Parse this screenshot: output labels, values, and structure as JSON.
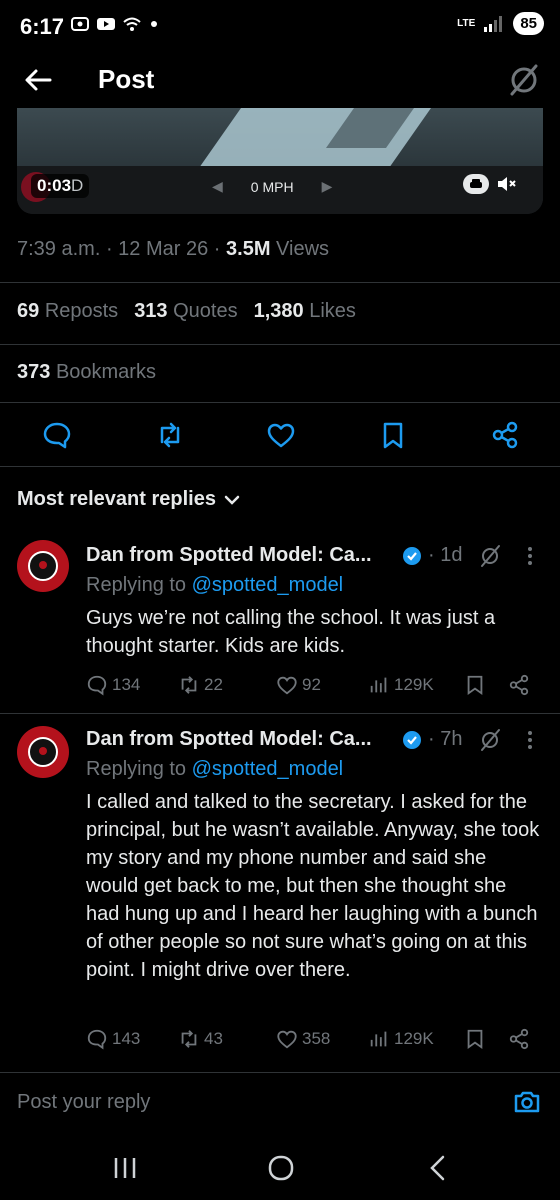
{
  "status_bar": {
    "time": "6:17",
    "network": "LTE",
    "battery": "85"
  },
  "header": {
    "title": "Post",
    "icons": [
      "back-arrow-icon",
      "grok-icon"
    ]
  },
  "video": {
    "elapsed": "0:03",
    "elapsed_suffix": "D",
    "speed": "0 MPH"
  },
  "post_meta": {
    "time": "7:39 a.m.",
    "date": "12 Mar 26",
    "views_count": "3.5M",
    "views_label": "Views"
  },
  "engagement": {
    "reposts_count": "69",
    "reposts_label": "Reposts",
    "quotes_count": "313",
    "quotes_label": "Quotes",
    "likes_count": "1,380",
    "likes_label": "Likes",
    "bookmarks_count": "373",
    "bookmarks_label": "Bookmarks"
  },
  "replies_header": {
    "label": "Most relevant replies"
  },
  "replies": [
    {
      "author": "Dan from Spotted Model: Ca...",
      "time": "1d",
      "replying_prefix": "Replying to",
      "replying_handle": "@spotted_model",
      "text": "Guys we’re not calling the school. It was just a thought starter. Kids are kids.",
      "replies": "134",
      "reposts": "22",
      "likes": "92",
      "views": "129K"
    },
    {
      "author": "Dan from Spotted Model: Ca...",
      "time": "7h",
      "replying_prefix": "Replying to",
      "replying_handle": "@spotted_model",
      "text": "I called and talked to the secretary. I asked for the principal, but he wasn’t available. Anyway, she took my story and my phone number and said she would get back to me, but then she thought she had hung up and I heard her laughing with a bunch of other people so not sure what’s going on at this point. I might drive over there.",
      "replies": "143",
      "reposts": "43",
      "likes": "358",
      "views": "129K"
    }
  ],
  "composer": {
    "placeholder": "Post your reply"
  },
  "colors": {
    "background": "#000000",
    "text": "#e7e9ea",
    "muted": "#71767b",
    "accent": "#1d9bf0",
    "divider": "#2f3336"
  }
}
